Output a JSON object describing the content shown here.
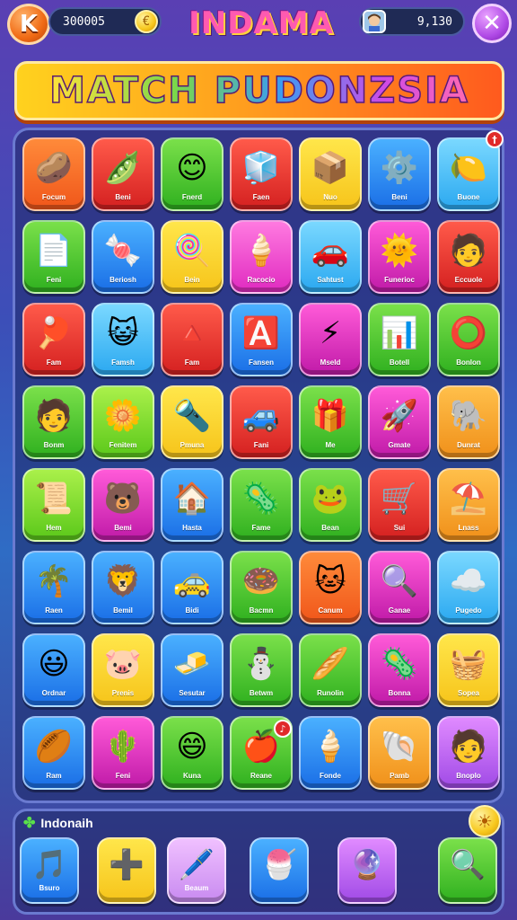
{
  "header": {
    "k_label": "K",
    "coins": "300005",
    "coin_icon": "€",
    "title": "INDAMA",
    "score": "9,130",
    "close_label": "✕"
  },
  "banner": {
    "text": "MATCH PUDONZSIA"
  },
  "tiles": [
    {
      "label": "Focum",
      "icon": "🥔",
      "color": "orange"
    },
    {
      "label": "Beni",
      "icon": "🫛",
      "color": "red"
    },
    {
      "label": "Fnerd",
      "icon": "😊",
      "color": "green"
    },
    {
      "label": "Faen",
      "icon": "🧊",
      "color": "red"
    },
    {
      "label": "Nuo",
      "icon": "📦",
      "color": "yellow"
    },
    {
      "label": "Beni",
      "icon": "⚙️",
      "color": "blue"
    },
    {
      "label": "Buone",
      "icon": "🍋",
      "color": "sky"
    },
    {
      "label": "Feni",
      "icon": "📄",
      "color": "green"
    },
    {
      "label": "Beriosh",
      "icon": "🍬",
      "color": "blue"
    },
    {
      "label": "Bein",
      "icon": "🍭",
      "color": "yellow"
    },
    {
      "label": "Racocio",
      "icon": "🍦",
      "color": "pink"
    },
    {
      "label": "Sahtust",
      "icon": "🚗",
      "color": "sky"
    },
    {
      "label": "Funerioc",
      "icon": "🌞",
      "color": "magenta"
    },
    {
      "label": "Eccuole",
      "icon": "🧑",
      "color": "red"
    },
    {
      "label": "Fam",
      "icon": "🏓",
      "color": "red"
    },
    {
      "label": "Famsh",
      "icon": "😺",
      "color": "sky"
    },
    {
      "label": "Fam",
      "icon": "🔺",
      "color": "red"
    },
    {
      "label": "Fansen",
      "icon": "🅰️",
      "color": "blue"
    },
    {
      "label": "Mseld",
      "icon": "⚡",
      "color": "magenta"
    },
    {
      "label": "Botell",
      "icon": "📊",
      "color": "green"
    },
    {
      "label": "Bonlon",
      "icon": "⭕",
      "color": "green"
    },
    {
      "label": "Bonm",
      "icon": "🧑",
      "color": "green"
    },
    {
      "label": "Fenitem",
      "icon": "🌼",
      "color": "lime"
    },
    {
      "label": "Pmuna",
      "icon": "🔦",
      "color": "yellow"
    },
    {
      "label": "Fani",
      "icon": "🚙",
      "color": "red"
    },
    {
      "label": "Me",
      "icon": "🎁",
      "color": "green"
    },
    {
      "label": "Gmate",
      "icon": "🚀",
      "color": "magenta"
    },
    {
      "label": "Dunrat",
      "icon": "🐘",
      "color": "amber"
    },
    {
      "label": "Hem",
      "icon": "📜",
      "color": "lime"
    },
    {
      "label": "Bemi",
      "icon": "🐻",
      "color": "magenta"
    },
    {
      "label": "Hasta",
      "icon": "🏠",
      "color": "blue"
    },
    {
      "label": "Fame",
      "icon": "🦠",
      "color": "green"
    },
    {
      "label": "Bean",
      "icon": "🐸",
      "color": "green"
    },
    {
      "label": "Sui",
      "icon": "🛒",
      "color": "red"
    },
    {
      "label": "Lnass",
      "icon": "⛱️",
      "color": "amber"
    },
    {
      "label": "Raen",
      "icon": "🌴",
      "color": "blue"
    },
    {
      "label": "Bemil",
      "icon": "🦁",
      "color": "blue"
    },
    {
      "label": "Bidi",
      "icon": "🚕",
      "color": "blue"
    },
    {
      "label": "Bacmn",
      "icon": "🍩",
      "color": "green"
    },
    {
      "label": "Canum",
      "icon": "🐱",
      "color": "orange"
    },
    {
      "label": "Ganae",
      "icon": "🔍",
      "color": "magenta"
    },
    {
      "label": "Pugedo",
      "icon": "☁️",
      "color": "sky"
    },
    {
      "label": "Ordnar",
      "icon": "😃",
      "color": "blue"
    },
    {
      "label": "Prenis",
      "icon": "🐷",
      "color": "yellow"
    },
    {
      "label": "Sesutar",
      "icon": "🧈",
      "color": "blue"
    },
    {
      "label": "Betwm",
      "icon": "⛄",
      "color": "green"
    },
    {
      "label": "Runolin",
      "icon": "🥖",
      "color": "green"
    },
    {
      "label": "Bonna",
      "icon": "🦠",
      "color": "magenta"
    },
    {
      "label": "Sopea",
      "icon": "🧺",
      "color": "yellow"
    },
    {
      "label": "Ram",
      "icon": "🏉",
      "color": "blue"
    },
    {
      "label": "Feni",
      "icon": "🌵",
      "color": "magenta"
    },
    {
      "label": "Kuna",
      "icon": "😄",
      "color": "green"
    },
    {
      "label": "Reane",
      "icon": "🍎",
      "color": "green"
    },
    {
      "label": "Fonde",
      "icon": "🍦",
      "color": "blue"
    },
    {
      "label": "Pamb",
      "icon": "🐚",
      "color": "amber"
    },
    {
      "label": "Bnoplo",
      "icon": "🧑",
      "color": "purple"
    }
  ],
  "badges": {
    "tile_top_right": "†",
    "tile_row8": "♪"
  },
  "bottom": {
    "label": "Indonaih",
    "clover_icon": "✤",
    "sun_icon": "☀",
    "tools": [
      {
        "label": "Bsuro",
        "icon": "🎵",
        "color": "blue"
      },
      {
        "label": "",
        "icon": "➕",
        "color": "yellow"
      },
      {
        "label": "Beaum",
        "icon": "🖊️",
        "color": "lavender"
      },
      {
        "label": "",
        "icon": "🍧",
        "color": "blue"
      },
      {
        "label": "",
        "icon": "🔮",
        "color": "purple"
      },
      {
        "label": "",
        "icon": "🔍",
        "color": "green"
      }
    ]
  }
}
